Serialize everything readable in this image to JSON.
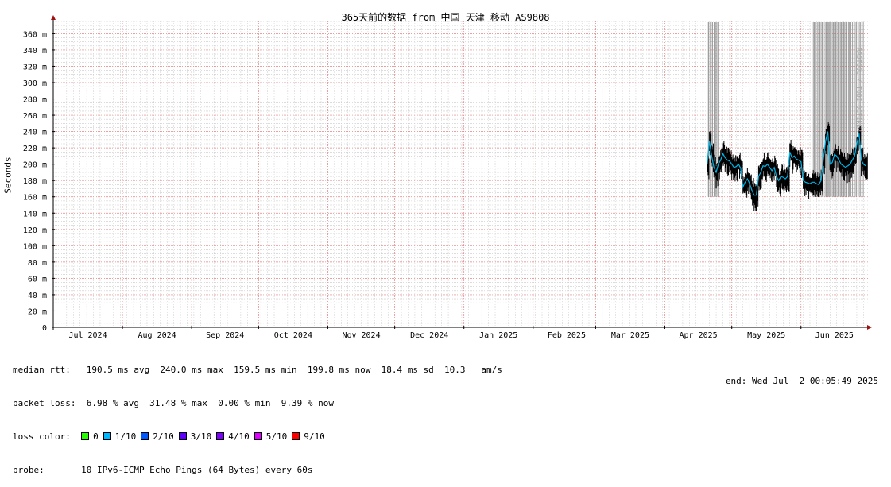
{
  "chart_data": {
    "type": "line",
    "title": "365天前的数据 from 中国 天津 移动 AS9808",
    "ylabel": "Seconds",
    "ylim": [
      0,
      375
    ],
    "ytick_values": [
      0,
      20,
      40,
      60,
      80,
      100,
      120,
      140,
      160,
      180,
      200,
      220,
      240,
      260,
      280,
      300,
      320,
      340,
      360
    ],
    "ytick_labels": [
      "0",
      "20 m",
      "40 m",
      "60 m",
      "80 m",
      "100 m",
      "120 m",
      "140 m",
      "160 m",
      "180 m",
      "200 m",
      "220 m",
      "240 m",
      "260 m",
      "280 m",
      "300 m",
      "320 m",
      "340 m",
      "360 m"
    ],
    "x_unit": "days",
    "xlim": [
      0,
      365
    ],
    "month_labels": [
      {
        "label": "Jul 2024",
        "x": 15.5
      },
      {
        "label": "Aug 2024",
        "x": 46.5
      },
      {
        "label": "Sep 2024",
        "x": 77
      },
      {
        "label": "Oct 2024",
        "x": 107.5
      },
      {
        "label": "Nov 2024",
        "x": 138
      },
      {
        "label": "Dec 2024",
        "x": 168.5
      },
      {
        "label": "Jan 2025",
        "x": 199.5
      },
      {
        "label": "Feb 2025",
        "x": 230
      },
      {
        "label": "Mar 2025",
        "x": 258.5
      },
      {
        "label": "Apr 2025",
        "x": 289
      },
      {
        "label": "May 2025",
        "x": 319.5
      },
      {
        "label": "Jun 2025",
        "x": 350
      }
    ],
    "month_boundaries": [
      31,
      62,
      92,
      123,
      153,
      184,
      215,
      243,
      274,
      304,
      335
    ],
    "grid": true,
    "series": [
      {
        "name": "median rtt",
        "x": [
          293,
          294,
          295,
          296,
          297,
          298,
          299,
          300,
          301,
          302,
          303,
          304,
          305,
          306,
          307,
          308,
          309,
          310,
          311,
          312,
          313,
          314,
          315,
          316,
          317,
          318,
          319,
          320,
          321,
          322,
          323,
          324,
          325,
          326,
          327,
          328,
          329,
          330,
          331,
          332,
          333,
          334,
          335,
          336,
          337,
          338,
          339,
          340,
          341,
          342,
          343,
          344,
          345,
          346,
          347,
          348,
          349,
          350,
          351,
          352,
          353,
          354,
          355,
          356,
          357,
          358,
          359,
          360,
          361,
          362,
          363,
          364
        ],
        "y": [
          200,
          228,
          210,
          196,
          190,
          200,
          205,
          213,
          208,
          205,
          204,
          200,
          196,
          197,
          200,
          195,
          172,
          178,
          182,
          176,
          168,
          162,
          162,
          185,
          190,
          198,
          197,
          200,
          196,
          192,
          196,
          185,
          180,
          185,
          184,
          182,
          185,
          215,
          208,
          210,
          206,
          205,
          203,
          180,
          178,
          177,
          176,
          178,
          178,
          176,
          175,
          180,
          205,
          228,
          240,
          200,
          202,
          212,
          210,
          205,
          200,
          198,
          196,
          198,
          200,
          205,
          210,
          225,
          238,
          205,
          200,
          198
        ],
        "color": "#000000"
      }
    ],
    "spikes_x": [
      293,
      293.6,
      294.2,
      294.8,
      295.4,
      296.1,
      296.7,
      297.3,
      297.8,
      340.5,
      341,
      341.8,
      342.5,
      343,
      343.5,
      344,
      344.5,
      345,
      345.8,
      346.3,
      346.8,
      347.2,
      347.6,
      348,
      348.5,
      349,
      349.5,
      350,
      350.6,
      351.1,
      351.6,
      352.1,
      352.6,
      353.1,
      353.6,
      354.1,
      354.6,
      355.1,
      355.6,
      356.2,
      356.7,
      357.3,
      358,
      358.7,
      359.3,
      359.9,
      360.5,
      361.1,
      361.7,
      362.3,
      362.9
    ],
    "colors": {
      "plot_bg": "#ffffff",
      "major_grid": "#e08080",
      "minor_grid": "#c8c8c8",
      "spike": "#888888",
      "smoke": "#000000",
      "median": "#00b4e8",
      "axis": "#000000",
      "arrow": "#a01010"
    }
  },
  "stats": {
    "median_rtt": "median rtt:   190.5 ms avg  240.0 ms max  159.5 ms min  199.8 ms now  18.4 ms sd  10.3   am/s",
    "packet_loss": "packet loss:  6.98 % avg  31.48 % max  0.00 % min  9.39 % now",
    "loss_color_label": "loss color:",
    "loss_colors": [
      {
        "label": "0",
        "color": "#26ff00"
      },
      {
        "label": "1/10",
        "color": "#00b8ff"
      },
      {
        "label": "2/10",
        "color": "#0059ff"
      },
      {
        "label": "3/10",
        "color": "#5e00ff"
      },
      {
        "label": "4/10",
        "color": "#7e00ff"
      },
      {
        "label": "5/10",
        "color": "#dd00ff"
      },
      {
        "label": "9/10",
        "color": "#ff0000"
      }
    ],
    "probe": "probe:       10 IPv6-ICMP Echo Pings (64 Bytes) every 60s",
    "end": "end: Wed Jul  2 00:05:49 2025"
  },
  "watermark": "RRDTOOL / TOBI OETIKER"
}
